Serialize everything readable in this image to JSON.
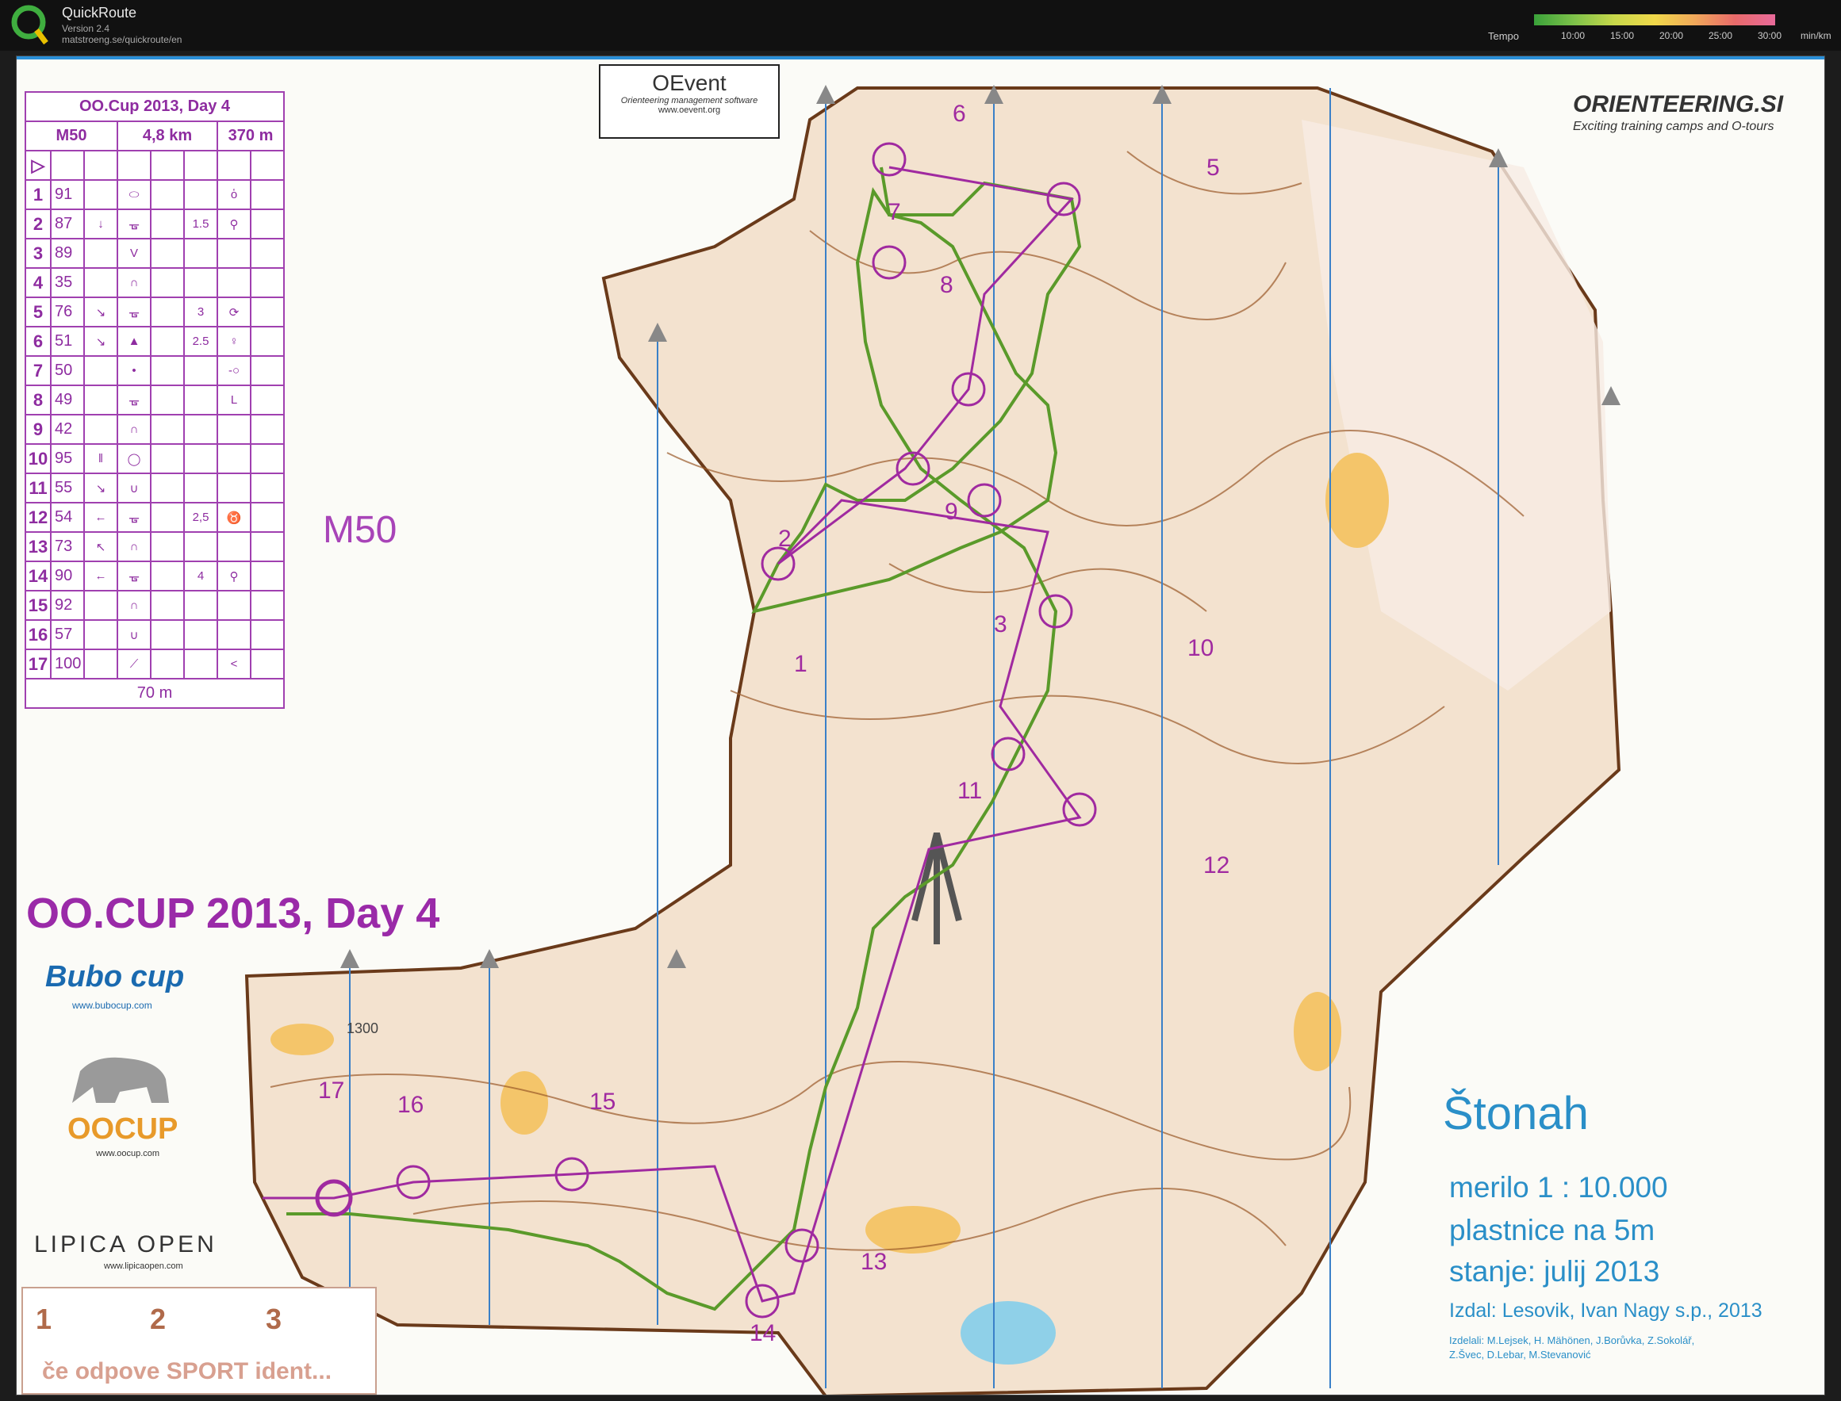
{
  "app": {
    "name": "QuickRoute",
    "version": "Version 2.4",
    "url": "matstroeng.se/quickroute/en",
    "tempo_label": "Tempo",
    "tempo_ticks": [
      "10:00",
      "15:00",
      "20:00",
      "25:00",
      "30:00"
    ],
    "tempo_unit": "min/km",
    "colors": {
      "titlebar": "#111111",
      "route": "#5a9a2a",
      "course": "#a02aa0"
    }
  },
  "map": {
    "class_label": "M50",
    "event_title": "OO.CUP 2013, Day 4",
    "area_name": "Štonah",
    "scale": "merilo 1 : 10.000",
    "contours": "plastnice na 5m",
    "state": "stanje: julij 2013",
    "publisher": "Izdal: Lesovik, Ivan Nagy s.p., 2013",
    "makers_line1": "Izdelali: M.Lejsek, H. Mähönen, J.Borůvka, Z.Sokolář,",
    "makers_line2": "Z.Švec, D.Lebar, M.Stevanović",
    "height_label": "1300",
    "brand_orienteering": "ORIENTEERING.SI",
    "brand_orienteering_tag": "Exciting training camps and O-tours",
    "oevent_title": "OEvent",
    "oevent_sub": "Orienteering management software",
    "oevent_url": "www.oevent.org",
    "bubo_name": "Bubo cup",
    "bubo_url": "www.bubocup.com",
    "oocup_name": "OOCUP",
    "oocup_url": "www.oocup.com",
    "lipica_name": "LIPICA OPEN",
    "lipica_url": "www.lipicaopen.com",
    "bottom_box": {
      "cols": [
        "1",
        "2",
        "3"
      ],
      "text": "če odpove SPORT ident..."
    },
    "controls": [
      "1",
      "2",
      "3",
      "5",
      "6",
      "7",
      "8",
      "9",
      "10",
      "11",
      "12",
      "13",
      "14",
      "15",
      "16",
      "17"
    ]
  },
  "descriptions": {
    "title": "OO.Cup 2013, Day 4",
    "class": "M50",
    "length": "4,8 km",
    "climb": "370 m",
    "start_symbol": "▷",
    "finish_distance": "70 m",
    "rows": [
      {
        "n": "1",
        "code": "91",
        "dir": "",
        "feat": "⬭",
        "dim": "",
        "loc": "ὁ"
      },
      {
        "n": "2",
        "code": "87",
        "dir": "↓",
        "feat": "ᚗ",
        "dim": "1.5",
        "loc": "⚲"
      },
      {
        "n": "3",
        "code": "89",
        "dir": "",
        "feat": "V",
        "dim": "",
        "loc": ""
      },
      {
        "n": "4",
        "code": "35",
        "dir": "",
        "feat": "∩",
        "dim": "",
        "loc": ""
      },
      {
        "n": "5",
        "code": "76",
        "dir": "↘",
        "feat": "ᚗ",
        "dim": "3",
        "loc": "⟳"
      },
      {
        "n": "6",
        "code": "51",
        "dir": "↘",
        "feat": "▲",
        "dim": "2.5",
        "loc": "♀"
      },
      {
        "n": "7",
        "code": "50",
        "dir": "",
        "feat": "•",
        "dim": "",
        "loc": "-○"
      },
      {
        "n": "8",
        "code": "49",
        "dir": "",
        "feat": "ᚗ",
        "dim": "",
        "loc": "L"
      },
      {
        "n": "9",
        "code": "42",
        "dir": "",
        "feat": "∩",
        "dim": "",
        "loc": ""
      },
      {
        "n": "10",
        "code": "95",
        "dir": "ǁ",
        "feat": "◯",
        "dim": "",
        "loc": ""
      },
      {
        "n": "11",
        "code": "55",
        "dir": "↘",
        "feat": "∪",
        "dim": "",
        "loc": ""
      },
      {
        "n": "12",
        "code": "54",
        "dir": "←",
        "feat": "ᚗ",
        "dim": "2,5",
        "loc": "♉"
      },
      {
        "n": "13",
        "code": "73",
        "dir": "↖",
        "feat": "∩",
        "dim": "",
        "loc": ""
      },
      {
        "n": "14",
        "code": "90",
        "dir": "←",
        "feat": "ᚗ",
        "dim": "4",
        "loc": "⚲"
      },
      {
        "n": "15",
        "code": "92",
        "dir": "",
        "feat": "∩",
        "dim": "",
        "loc": ""
      },
      {
        "n": "16",
        "code": "57",
        "dir": "",
        "feat": "∪",
        "dim": "",
        "loc": ""
      },
      {
        "n": "17",
        "code": "100",
        "dir": "",
        "feat": "⟋",
        "dim": "",
        "loc": "<"
      }
    ]
  }
}
